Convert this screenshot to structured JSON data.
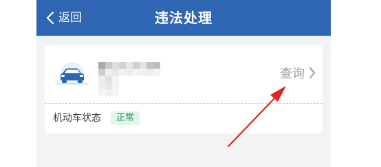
{
  "header": {
    "back_label": "返回",
    "title": "违法处理",
    "background": "#2f66b3"
  },
  "vehicle_card": {
    "car_icon": "car-icon",
    "plate": "",
    "query_label": "查询",
    "status_label": "机动车状态",
    "status_value": "正常",
    "status_color": "#2f9e63"
  },
  "annotation": {
    "color": "#e3231f",
    "icon": "red-arrow"
  }
}
